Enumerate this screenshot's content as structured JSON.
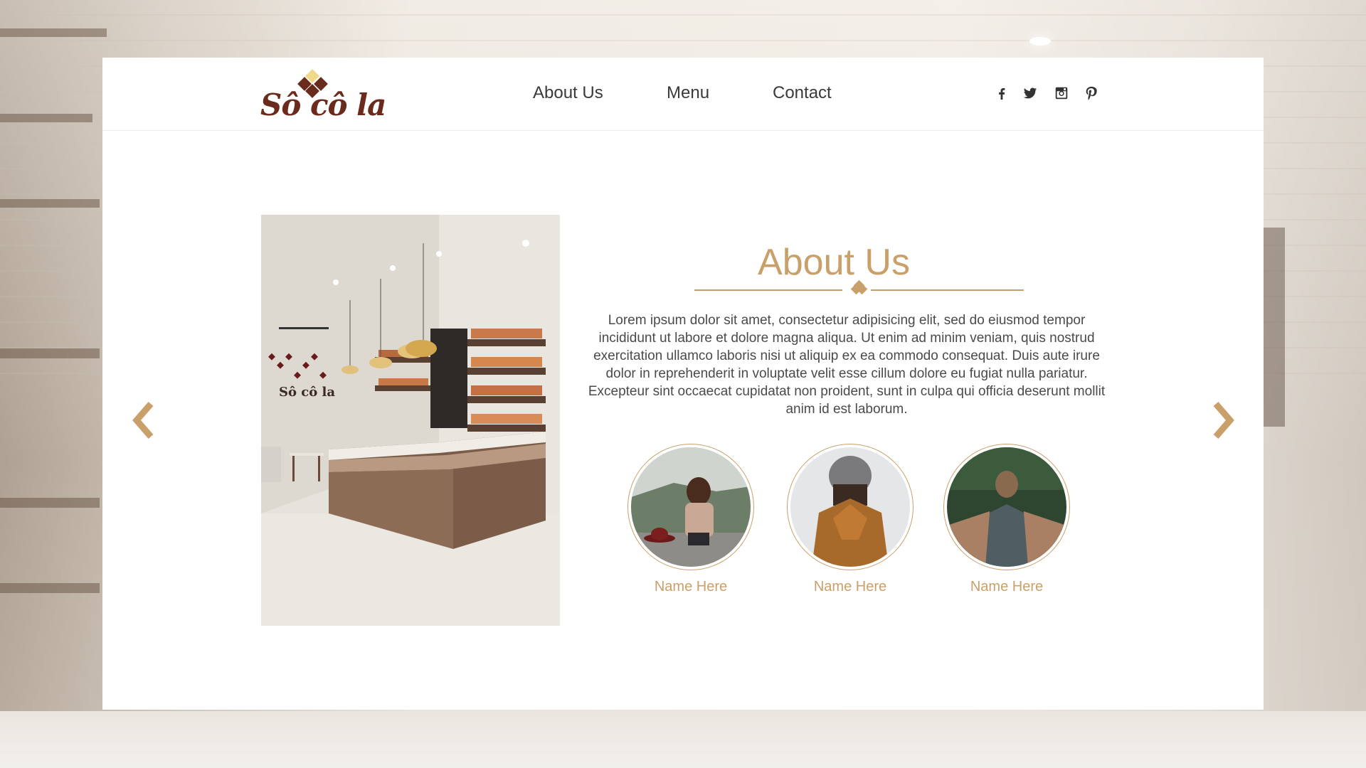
{
  "brand": {
    "logo_text": "Sô cô la"
  },
  "nav": {
    "items": [
      {
        "label": "About Us"
      },
      {
        "label": "Menu"
      },
      {
        "label": "Contact"
      }
    ]
  },
  "social": {
    "icons": [
      "facebook-icon",
      "twitter-icon",
      "instagram-icon",
      "pinterest-icon"
    ]
  },
  "about": {
    "title": "About Us",
    "body": "Lorem ipsum dolor sit amet, consectetur adipisicing elit, sed do eiusmod tempor incididunt ut labore et dolore magna aliqua. Ut enim ad minim veniam, quis nostrud exercitation ullamco laboris nisi ut aliquip ex ea commodo consequat. Duis aute irure dolor in reprehenderit in voluptate velit esse cillum dolore eu fugiat nulla pariatur. Excepteur sint occaecat cupidatat non proident, sunt in culpa qui officia deserunt mollit anim id est laborum.",
    "team": [
      {
        "name": "Name Here"
      },
      {
        "name": "Name Here"
      },
      {
        "name": "Name Here"
      }
    ]
  },
  "carousel": {
    "prev_icon": "chevron-left-icon",
    "next_icon": "chevron-right-icon"
  },
  "colors": {
    "accent": "#c9a06a",
    "brand": "#6a2a1c",
    "text": "#4a4a4a"
  }
}
